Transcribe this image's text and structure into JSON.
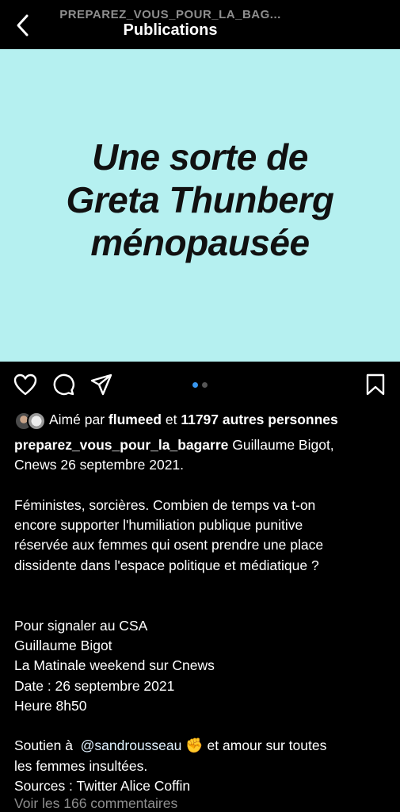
{
  "header": {
    "account_name": "PREPAREZ_VOUS_POUR_LA_BAG...",
    "title": "Publications"
  },
  "post": {
    "image_text": "Une sorte de\nGreta Thunberg\nménopausée",
    "image_bg_color": "#b5f0f0",
    "carousel": {
      "count": 2,
      "active_index": 0
    }
  },
  "likes": {
    "prefix": "Aimé par ",
    "user": "flumeed",
    "connector": " et ",
    "others": "11797 autres personnes"
  },
  "caption": {
    "username": "preparez_vous_pour_la_bagarre",
    "line1_rest": " Guillaume Bigot,",
    "line2": "Cnews 26 septembre 2021.",
    "para2_lines": [
      "Féministes, sorcières. Combien de temps va t-on",
      "encore supporter l'humiliation publique punitive",
      "réservée aux femmes qui osent prendre une place",
      "dissidente dans l'espace politique et médiatique ?"
    ],
    "para3_lines": [
      "Pour signaler au CSA",
      "Guillaume Bigot",
      "La Matinale weekend sur Cnews",
      "Date : 26 septembre 2021",
      "Heure 8h50"
    ],
    "support_prefix": "Soutien à  ",
    "mention": "@sandrousseau",
    "emoji": "✊",
    "support_suffix": " et amour sur toutes",
    "support_line2": "les femmes insultées.",
    "sources": "Sources : Twitter Alice Coffin"
  },
  "comments_link": "Voir les 166 commentaires",
  "icons": {
    "back": "chevron-left-icon",
    "like": "heart-icon",
    "comment": "comment-icon",
    "share": "paper-plane-icon",
    "save": "bookmark-icon"
  }
}
